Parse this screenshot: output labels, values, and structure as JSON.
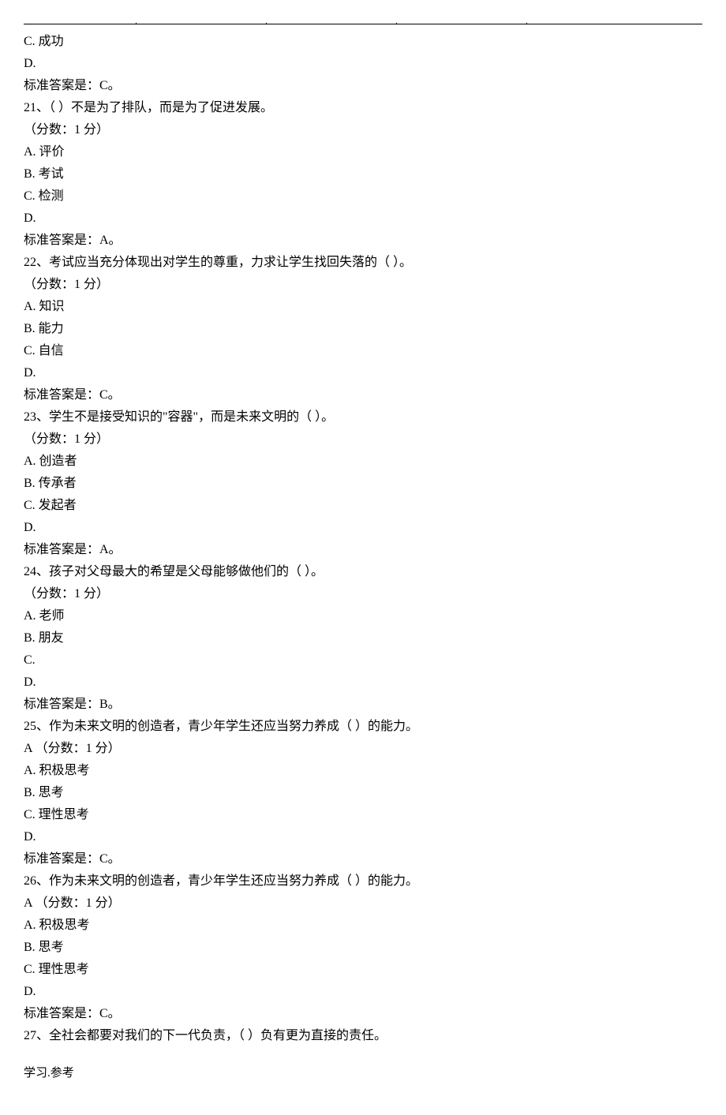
{
  "header_dots": ".        .        .        .",
  "q20_remainder": {
    "optC": "C. 成功",
    "optD": "D.",
    "answer": "标准答案是：C。"
  },
  "q21": {
    "stem": "21、（    ）不是为了排队，而是为了促进发展。",
    "points": "（分数：1 分）",
    "optA": "A. 评价",
    "optB": "B. 考试",
    "optC": "C. 检测",
    "optD": "D.",
    "answer": "标准答案是：A。"
  },
  "q22": {
    "stem": "22、考试应当充分体现出对学生的尊重，力求让学生找回失落的（      ）。",
    "points": "（分数：1 分）",
    "optA": "A. 知识",
    "optB": "B. 能力",
    "optC": "C. 自信",
    "optD": "D.",
    "answer": "标准答案是：C。"
  },
  "q23": {
    "stem": "23、学生不是接受知识的\"容器\"，而是未来文明的（        ）。",
    "points": "（分数：1 分）",
    "optA": "A. 创造者",
    "optB": "B. 传承者",
    "optC": "C. 发起者",
    "optD": "D.",
    "answer": "标准答案是：A。"
  },
  "q24": {
    "stem": "24、孩子对父母最大的希望是父母能够做他们的（      ）。",
    "points": "（分数：1 分）",
    "optA": "A. 老师",
    "optB": "B. 朋友",
    "optC": "C.",
    "optD": "D.",
    "answer": "标准答案是：B。"
  },
  "q25": {
    "stem": "25、作为未来文明的创造者，青少年学生还应当努力养成（    ）的能力。",
    "points": "A （分数：1 分）",
    "optA": "A. 积极思考",
    "optB": "B. 思考",
    "optC": "C. 理性思考",
    "optD": "D.",
    "answer": "标准答案是：C。"
  },
  "q26": {
    "stem": "26、作为未来文明的创造者，青少年学生还应当努力养成（    ）的能力。",
    "points": "A （分数：1 分）",
    "optA": "A. 积极思考",
    "optB": "B. 思考",
    "optC": "C. 理性思考",
    "optD": "D.",
    "answer": "标准答案是：C。"
  },
  "q27": {
    "stem": "27、全社会都要对我们的下一代负责，（    ）负有更为直接的责任。"
  },
  "footer": "学习.参考"
}
